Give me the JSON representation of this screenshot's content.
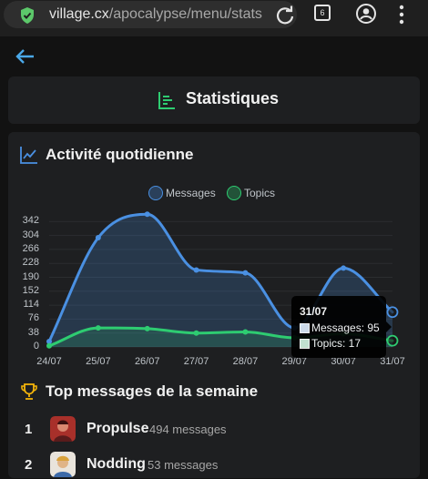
{
  "browser": {
    "url_domain": "village.cx",
    "url_path": "/apocalypse/menu/stats",
    "tab_count": "6"
  },
  "page": {
    "title": "Statistiques"
  },
  "activity": {
    "heading": "Activité quotidienne"
  },
  "chart_data": {
    "type": "line",
    "categories": [
      "24/07",
      "25/07",
      "26/07",
      "27/07",
      "28/07",
      "29/07",
      "30/07",
      "31/07"
    ],
    "series": [
      {
        "name": "Messages",
        "values": [
          15,
          298,
          362,
          210,
          202,
          52,
          215,
          95
        ],
        "color": "#4a90e2"
      },
      {
        "name": "Topics",
        "values": [
          3,
          52,
          50,
          38,
          41,
          25,
          36,
          17
        ],
        "color": "#2ecc71"
      }
    ],
    "y_ticks": [
      "342",
      "304",
      "266",
      "228",
      "190",
      "152",
      "114",
      "76",
      "38",
      "0"
    ],
    "ylim": [
      0,
      380
    ],
    "smooth": true,
    "filled": true,
    "legend_position": "top-center",
    "tooltip": {
      "title": "31/07",
      "rows": [
        "Messages: 95",
        "Topics: 17"
      ]
    }
  },
  "top_messages": {
    "heading": "Top messages de la semaine",
    "entries": [
      {
        "rank": "1",
        "name": "Propulse",
        "count": "494 messages"
      },
      {
        "rank": "2",
        "name": "Nodding",
        "count": "53 messages"
      }
    ]
  },
  "colors": {
    "accent_blue": "#4a90e2",
    "accent_green": "#2ecc71",
    "trophy": "#f5b50a",
    "background": "#121212",
    "card": "#1e1f21"
  }
}
